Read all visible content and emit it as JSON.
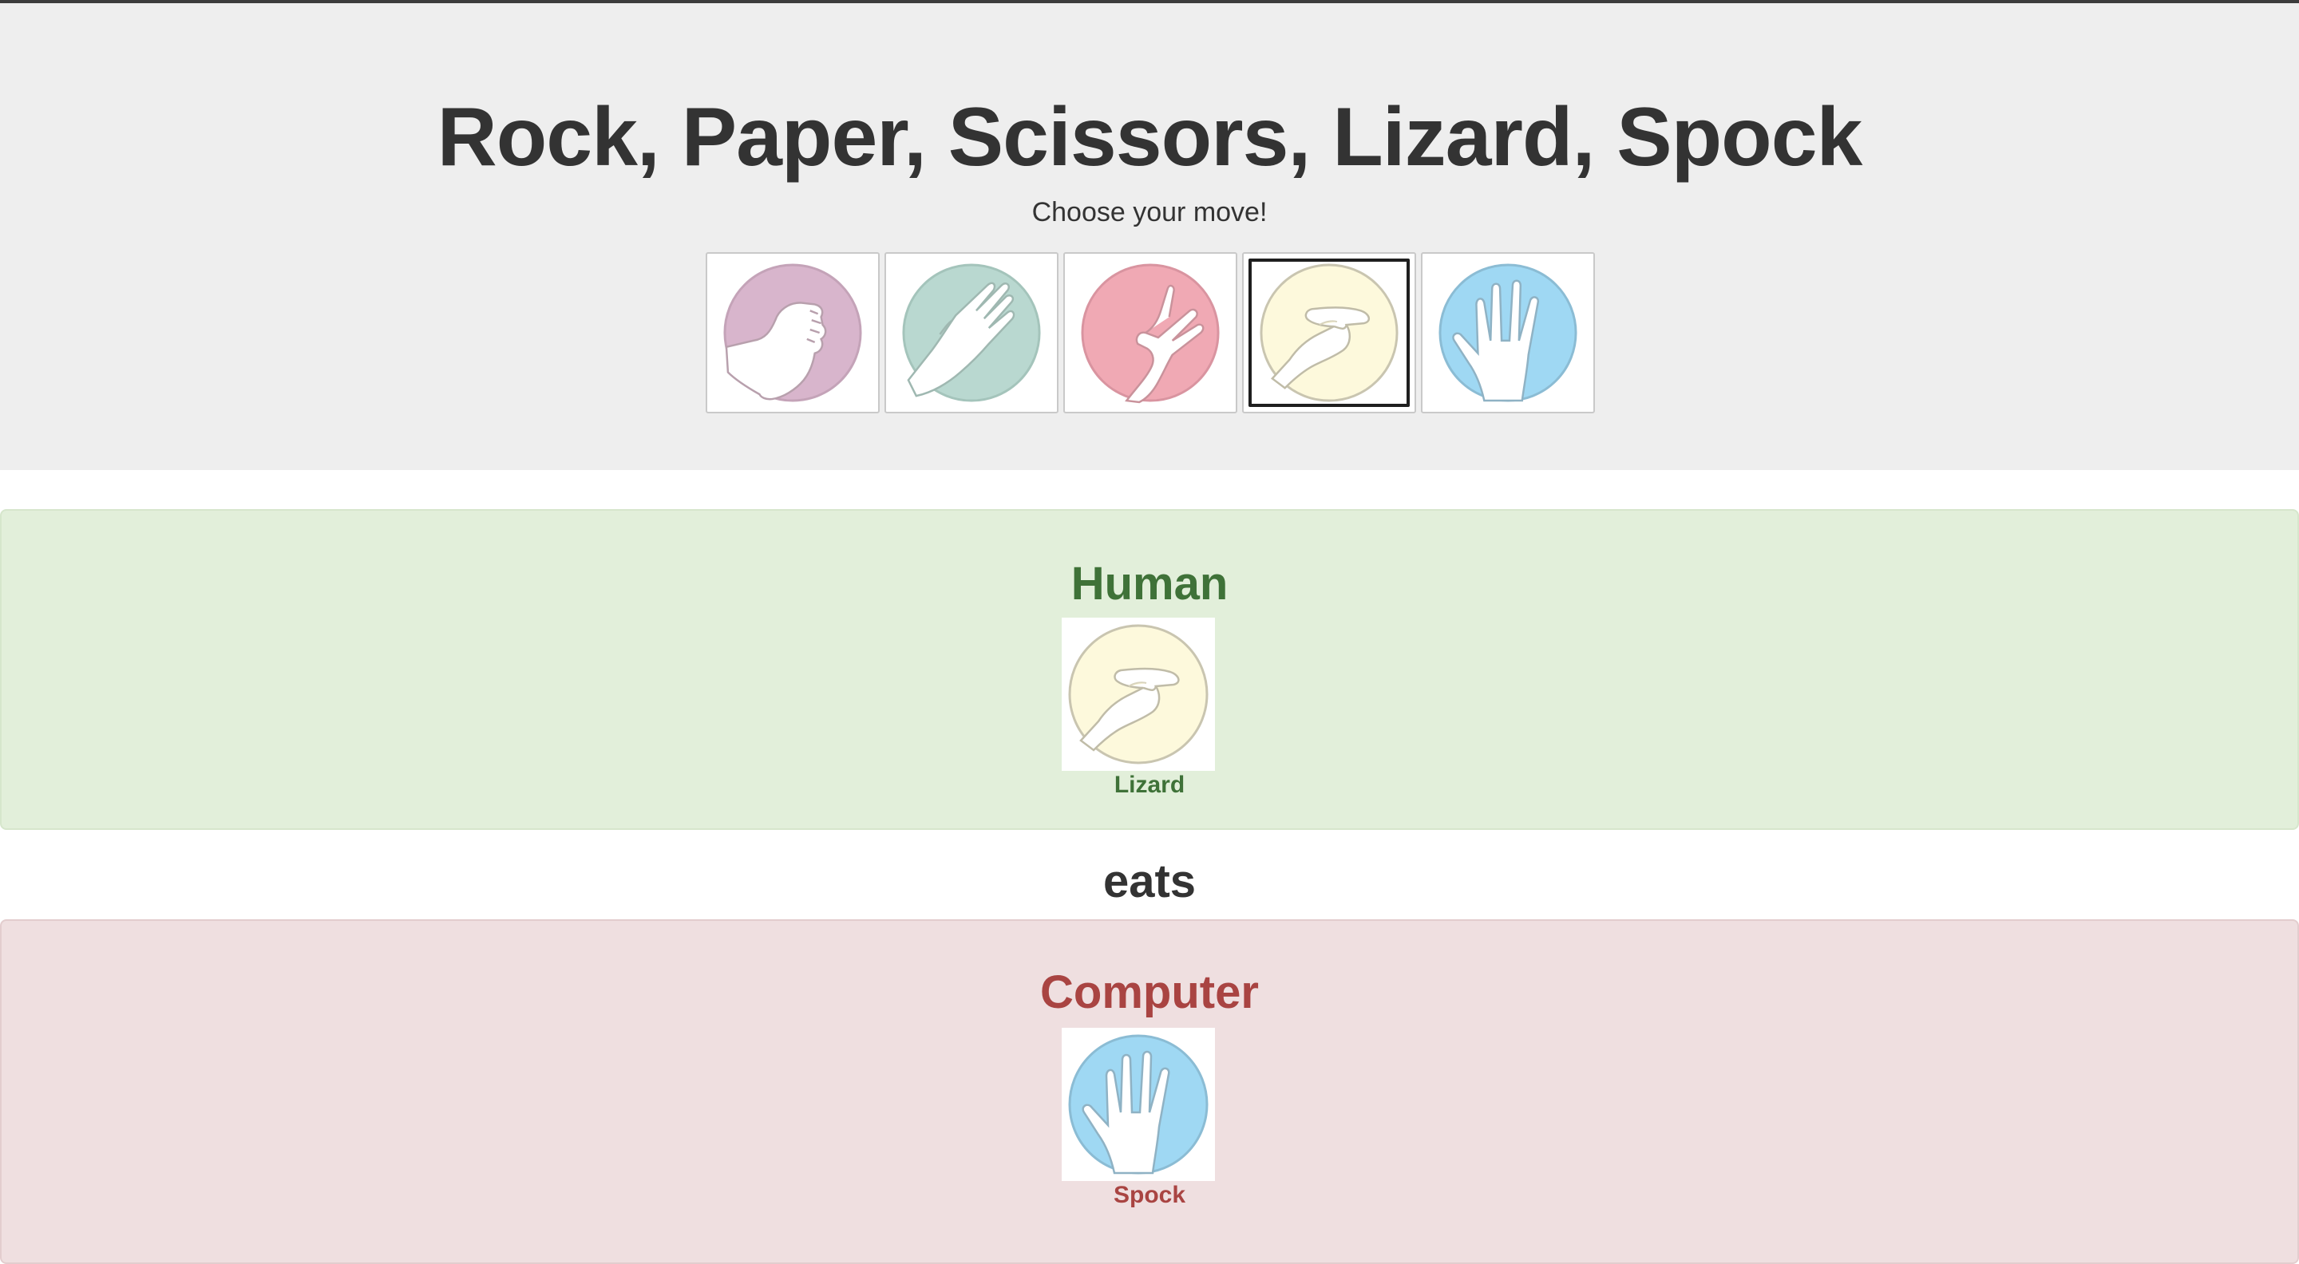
{
  "header": {
    "title": "Rock, Paper, Scissors, Lizard, Spock",
    "subtitle": "Choose your move!"
  },
  "moves": [
    {
      "name": "Rock",
      "icon": "rock-hand-icon",
      "color": "#d8b5cc",
      "selected": false
    },
    {
      "name": "Paper",
      "icon": "paper-hand-icon",
      "color": "#b9d8d0",
      "selected": false
    },
    {
      "name": "Scissors",
      "icon": "scissors-hand-icon",
      "color": "#f0a9b4",
      "selected": false
    },
    {
      "name": "Lizard",
      "icon": "lizard-hand-icon",
      "color": "#fdf9dc",
      "selected": true
    },
    {
      "name": "Spock",
      "icon": "spock-hand-icon",
      "color": "#9fd8f3",
      "selected": false
    }
  ],
  "result": {
    "human": {
      "heading": "Human",
      "choice": "Lizard",
      "color": "#3f7238"
    },
    "verb": "eats",
    "computer": {
      "heading": "Computer",
      "choice": "Spock",
      "color": "#a94442"
    }
  },
  "colors": {
    "jumbotron": "#eeeeee",
    "human_panel": "#e2efda",
    "computer_panel": "#efdfe0"
  }
}
